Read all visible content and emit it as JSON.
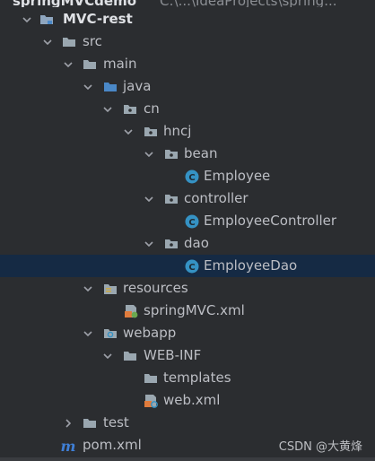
{
  "header": {
    "project": "springMVCdemo",
    "path": "C:\\...\\IdeaProjects\\spring..."
  },
  "tree": {
    "module": "MVC-rest",
    "src": "src",
    "main": "main",
    "java": "java",
    "cn": "cn",
    "hncj": "hncj",
    "bean": "bean",
    "employee": "Employee",
    "controller": "controller",
    "employee_controller": "EmployeeController",
    "dao": "dao",
    "employee_dao": "EmployeeDao",
    "resources": "resources",
    "springmvc_xml": "springMVC.xml",
    "webapp": "webapp",
    "web_inf": "WEB-INF",
    "templates": "templates",
    "web_xml": "web.xml",
    "test": "test",
    "pom_xml": "pom.xml"
  },
  "watermark": "CSDN @大黄烽",
  "colors": {
    "background": "#2b2d30",
    "selection": "#152a44",
    "text": "#bcbec4",
    "class_icon": "#3592c4",
    "maven_icon": "#3f7fd6",
    "xml_icon": "#e07b3c"
  }
}
